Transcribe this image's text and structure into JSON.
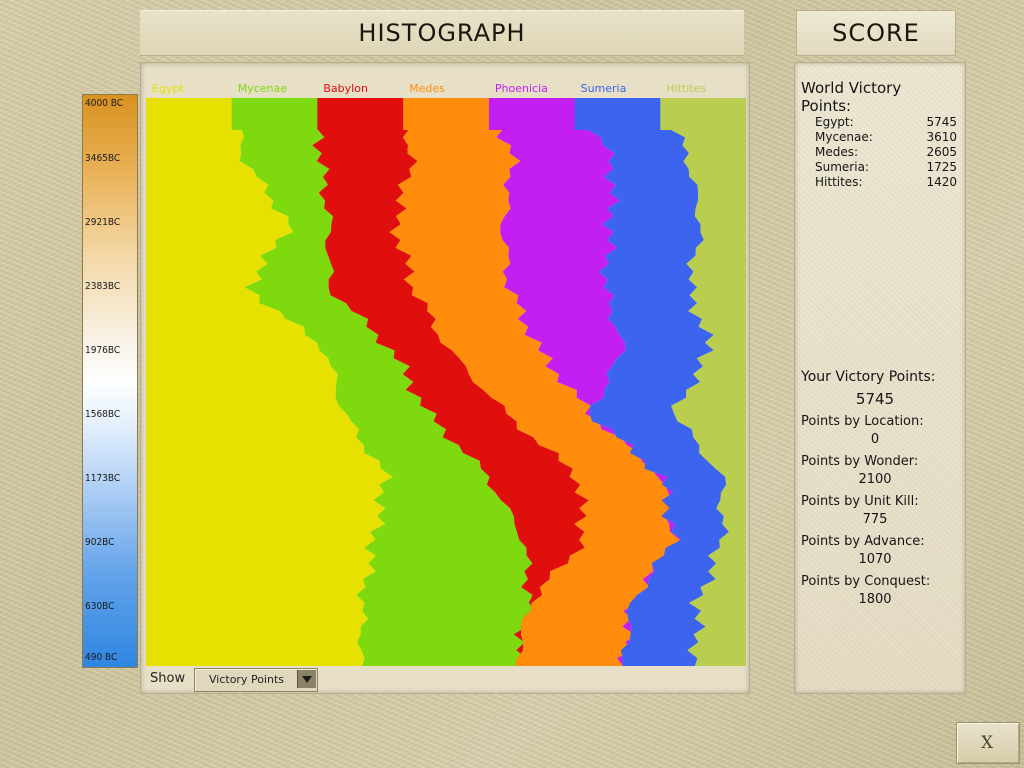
{
  "header": {
    "title": "HISTOGRAPH",
    "score_title": "SCORE"
  },
  "timeline": [
    "4000 BC",
    "3465BC",
    "2921BC",
    "2383BC",
    "1976BC",
    "1568BC",
    "1173BC",
    "902BC",
    "630BC",
    "490 BC"
  ],
  "civs": [
    {
      "name": "Egypt",
      "color": "#e6e100",
      "label_color": "#ffffff"
    },
    {
      "name": "Mycenae",
      "color": "#7ed90f",
      "label_color": "#ffffff"
    },
    {
      "name": "Babylon",
      "color": "#e10e0e",
      "label_color": "#b1b1b1"
    },
    {
      "name": "Medes",
      "color": "#ff8d0b",
      "label_color": "#ffffff"
    },
    {
      "name": "Phoenicia",
      "color": "#c41ff2",
      "label_color": "#cbcbcb"
    },
    {
      "name": "Sumeria",
      "color": "#3d64ee",
      "label_color": "#ffffff"
    },
    {
      "name": "Hittites",
      "color": "#b9cd4f",
      "label_color": "#ffffff"
    }
  ],
  "chart_data": {
    "type": "area",
    "orientation": "vertical-time",
    "time_axis": [
      "4000 BC",
      "3465BC",
      "2921BC",
      "2383BC",
      "1976BC",
      "1568BC",
      "1173BC",
      "902BC",
      "630BC",
      "490 BC"
    ],
    "series": [
      {
        "name": "Egypt",
        "values": [
          14.3,
          16.5,
          24,
          17,
          30,
          33,
          40,
          38,
          36,
          36
        ]
      },
      {
        "name": "Mycenae",
        "values": [
          14.3,
          12.7,
          6.5,
          13.5,
          11,
          14,
          17,
          25,
          28,
          25.5
        ]
      },
      {
        "name": "Babylon",
        "values": [
          14.3,
          15,
          11,
          14,
          9.5,
          13,
          15,
          10,
          0,
          0
        ]
      },
      {
        "name": "Medes",
        "values": [
          14.3,
          17,
          18,
          16,
          15,
          14,
          14,
          15,
          17,
          18
        ]
      },
      {
        "name": "Phoenicia",
        "values": [
          14.3,
          16.5,
          18,
          16,
          14,
          0,
          0,
          0,
          0,
          0
        ]
      },
      {
        "name": "Sumeria",
        "values": [
          14.3,
          12.8,
          15,
          14,
          14.5,
          14,
          10,
          8,
          11,
          12
        ]
      },
      {
        "name": "Hittites",
        "values": [
          14.2,
          9.5,
          7.5,
          9.5,
          6,
          12,
          4,
          4,
          8,
          8.5
        ]
      }
    ]
  },
  "show": {
    "label": "Show",
    "value": "Victory Points"
  },
  "world_victory": {
    "title": "World Victory Points:",
    "entries": [
      {
        "civ": "Egypt:",
        "points": "5745"
      },
      {
        "civ": "Mycenae:",
        "points": "3610"
      },
      {
        "civ": "Medes:",
        "points": "2605"
      },
      {
        "civ": "Sumeria:",
        "points": "1725"
      },
      {
        "civ": "Hittites:",
        "points": "1420"
      }
    ]
  },
  "your_victory": {
    "title": "Your Victory Points:",
    "total": "5745",
    "breakdown": [
      {
        "label": "Points by Location:",
        "value": "0"
      },
      {
        "label": "Points by Wonder:",
        "value": "2100"
      },
      {
        "label": "Points by Unit Kill:",
        "value": "775"
      },
      {
        "label": "Points by Advance:",
        "value": "1070"
      },
      {
        "label": "Points by Conquest:",
        "value": "1800"
      }
    ]
  },
  "close": {
    "glyph": "X"
  }
}
